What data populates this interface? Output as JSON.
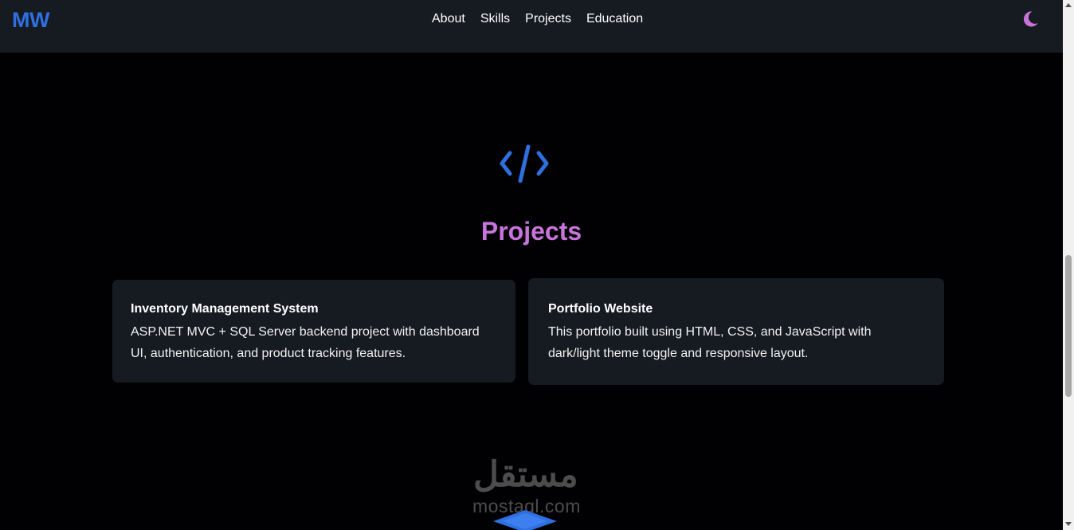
{
  "navbar": {
    "logo": "MW",
    "links": [
      "About",
      "Skills",
      "Projects",
      "Education"
    ],
    "theme_icon": "moon-icon"
  },
  "projects": {
    "icon": "code-icon",
    "title": "Projects",
    "cards": [
      {
        "title": "Inventory Management System",
        "description": "ASP.NET MVC + SQL Server backend project with dashboard UI, authentication, and product tracking features."
      },
      {
        "title": "Portfolio Website",
        "description": "This portfolio built using HTML, CSS, and JavaScript with dark/light theme toggle and responsive layout."
      }
    ]
  },
  "watermark": {
    "arabic": "مستقل",
    "latin": "mostaql.com"
  },
  "next_section_icon": "graduation-cap-icon",
  "colors": {
    "accent_blue": "#2f6fe0",
    "accent_purple": "#c874dc",
    "background": "#010103",
    "surface": "#161a21"
  }
}
